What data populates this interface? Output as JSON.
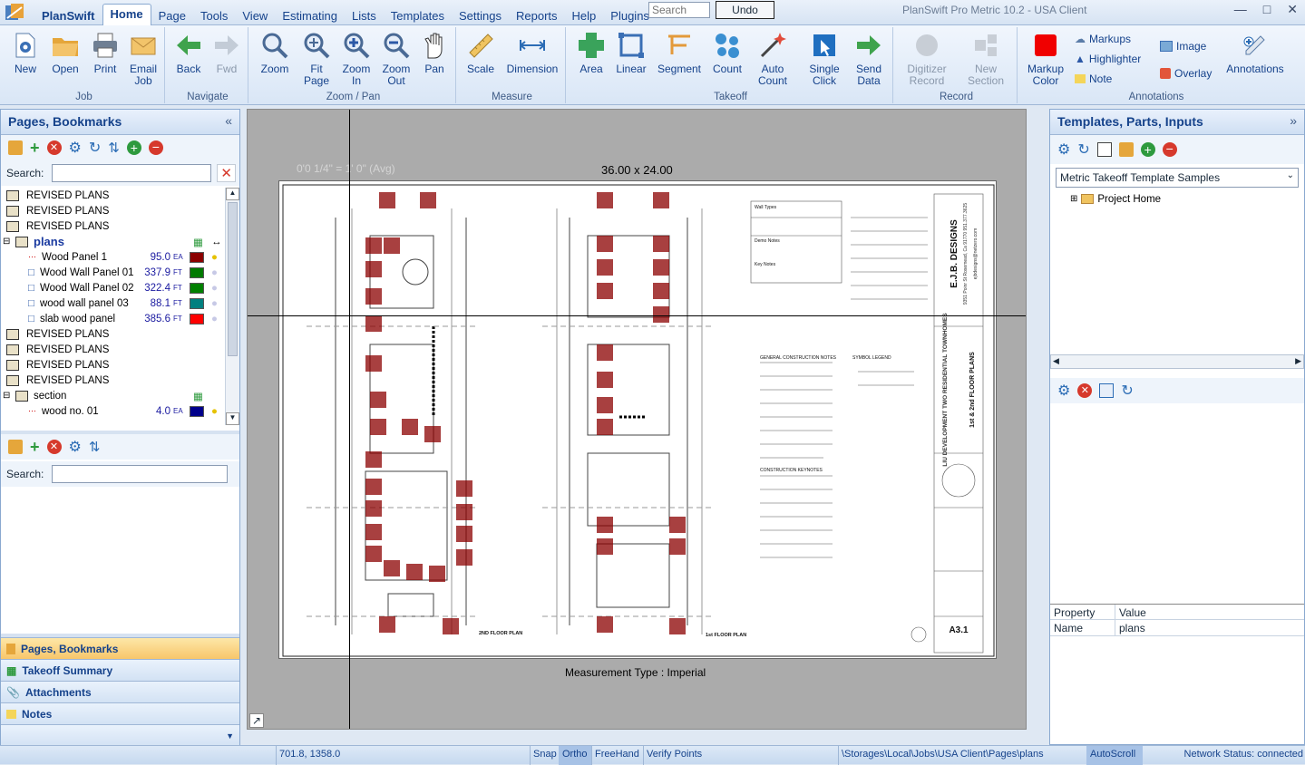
{
  "app": {
    "logo_label": "PlanSwift",
    "title": "PlanSwift Pro Metric 10.2 - USA Client"
  },
  "menu": {
    "items": [
      "Home",
      "Page",
      "Tools",
      "View",
      "Estimating",
      "Lists",
      "Templates",
      "Settings",
      "Reports",
      "Help",
      "Plugins"
    ]
  },
  "search_placeholder": "Search",
  "undo_label": "Undo",
  "ribbon": {
    "job": {
      "label": "Job",
      "new": "New",
      "open": "Open",
      "print": "Print",
      "email": "Email",
      "email2": "Job"
    },
    "navigate": {
      "label": "Navigate",
      "back": "Back",
      "fwd": "Fwd"
    },
    "zoom": {
      "label": "Zoom / Pan",
      "zoom": "Zoom",
      "fit1": "Fit",
      "fit2": "Page",
      "zin1": "Zoom",
      "zin2": "In",
      "zout1": "Zoom",
      "zout2": "Out",
      "pan": "Pan"
    },
    "measure": {
      "label": "Measure",
      "scale": "Scale",
      "dimension": "Dimension"
    },
    "takeoff": {
      "label": "Takeoff",
      "area": "Area",
      "linear": "Linear",
      "segment": "Segment",
      "count": "Count",
      "auto1": "Auto",
      "auto2": "Count"
    },
    "single": {
      "s1": "Single",
      "s2": "Click",
      "d1": "Send",
      "d2": "Data"
    },
    "record": {
      "label": "Record",
      "dig1": "Digitizer",
      "dig2": "Record",
      "ns1": "New",
      "ns2": "Section"
    },
    "annotations": {
      "label": "Annotations",
      "mc1": "Markup",
      "mc2": "Color",
      "markups": "Markups",
      "highlighter": "Highlighter",
      "note": "Note",
      "image": "Image",
      "overlay": "Overlay",
      "annotations": "Annotations"
    }
  },
  "left_pane": {
    "title": "Pages, Bookmarks",
    "search_label": "Search:",
    "search2_label": "Search:",
    "tree": [
      {
        "label": "REVISED PLANS"
      },
      {
        "label": "REVISED PLANS"
      },
      {
        "label": "REVISED PLANS"
      },
      {
        "label": "plans"
      },
      {
        "label": "Wood Panel 1",
        "value": "95.0",
        "unit": "EA",
        "color": "#8b0000"
      },
      {
        "label": "Wood Wall Panel 01",
        "value": "337.9",
        "unit": "FT",
        "color": "#007a00"
      },
      {
        "label": "Wood Wall Panel 02",
        "value": "322.4",
        "unit": "FT",
        "color": "#008000"
      },
      {
        "label": "wood wall panel 03",
        "value": "88.1",
        "unit": "FT",
        "color": "#008080"
      },
      {
        "label": "slab wood panel",
        "value": "385.6",
        "unit": "FT",
        "color": "#ff0000"
      },
      {
        "label": "REVISED PLANS"
      },
      {
        "label": "REVISED PLANS"
      },
      {
        "label": "REVISED PLANS"
      },
      {
        "label": "REVISED PLANS"
      },
      {
        "label": "section"
      },
      {
        "label": "wood no. 01",
        "value": "4.0",
        "unit": "EA",
        "color": "#00008b"
      }
    ],
    "tabs": [
      "Pages, Bookmarks",
      "Takeoff Summary",
      "Attachments",
      "Notes"
    ]
  },
  "canvas": {
    "scale_text": "0'0 1/4\" = 1' 0\" (Avg)",
    "sheet_size": "36.00 x 24.00",
    "measurement_type": "Measurement Type : Imperial",
    "firm": "E.J.B. DESIGNS",
    "firm_addr": "9351 Poinr St  Rosemead, Ca 91770  951.377.3625",
    "firm_email": "ejbdesigns@netzero.com",
    "project": "LIU DEVELOPMENT  TWO RESIDENTIAL TOWNHOMES",
    "sheet_title": "1st & 2nd FLOOR PLANS",
    "sheet_no": "A3.1",
    "plan2": "2ND FLOOR PLAN",
    "plan1": "1st FLOOR PLAN",
    "gcn": "GENERAL CONSTRUCTION NOTES",
    "legend": "SYMBOL LEGEND",
    "keynotes": "CONSTRUCTION KEYNOTES",
    "wall_types": "Wall Types",
    "demo_notes": "Demo Notes",
    "key_notes": "Key Notes"
  },
  "right_pane": {
    "title": "Templates, Parts, Inputs",
    "template_select": "Metric Takeoff Template Samples",
    "project_home": "Project Home",
    "prop_header": "Property",
    "value_header": "Value",
    "prop_name": "Name",
    "prop_value": "plans"
  },
  "status": {
    "coords": "701.8, 1358.0",
    "snap": "Snap",
    "ortho": "Ortho",
    "freehand": "FreeHand",
    "verify": "Verify Points",
    "path": "\\Storages\\Local\\Jobs\\USA Client\\Pages\\plans",
    "autoscroll": "AutoScroll",
    "network": "Network Status: connected"
  }
}
